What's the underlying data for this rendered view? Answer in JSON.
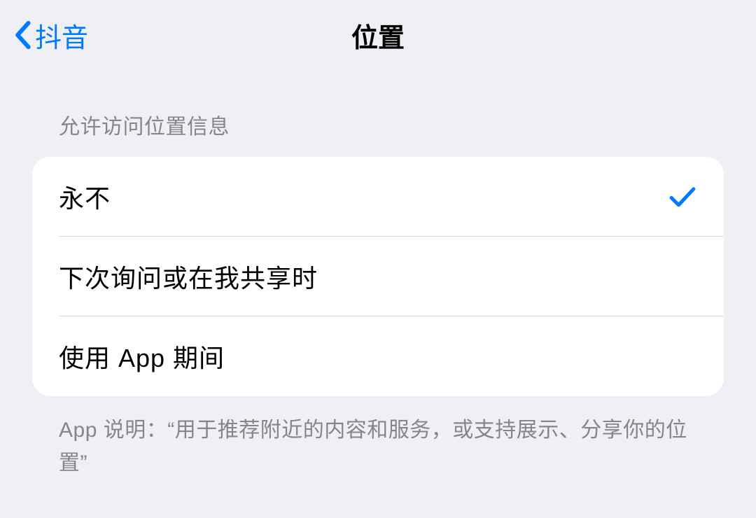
{
  "nav": {
    "back_label": "抖音",
    "title": "位置"
  },
  "section": {
    "header": "允许访问位置信息",
    "options": [
      {
        "label": "永不",
        "selected": true
      },
      {
        "label": "下次询问或在我共享时",
        "selected": false
      },
      {
        "label": "使用 App 期间",
        "selected": false
      }
    ],
    "footer": "App 说明：“用于推荐附近的内容和服务，或支持展示、分享你的位置”"
  },
  "colors": {
    "accent": "#007aff"
  }
}
